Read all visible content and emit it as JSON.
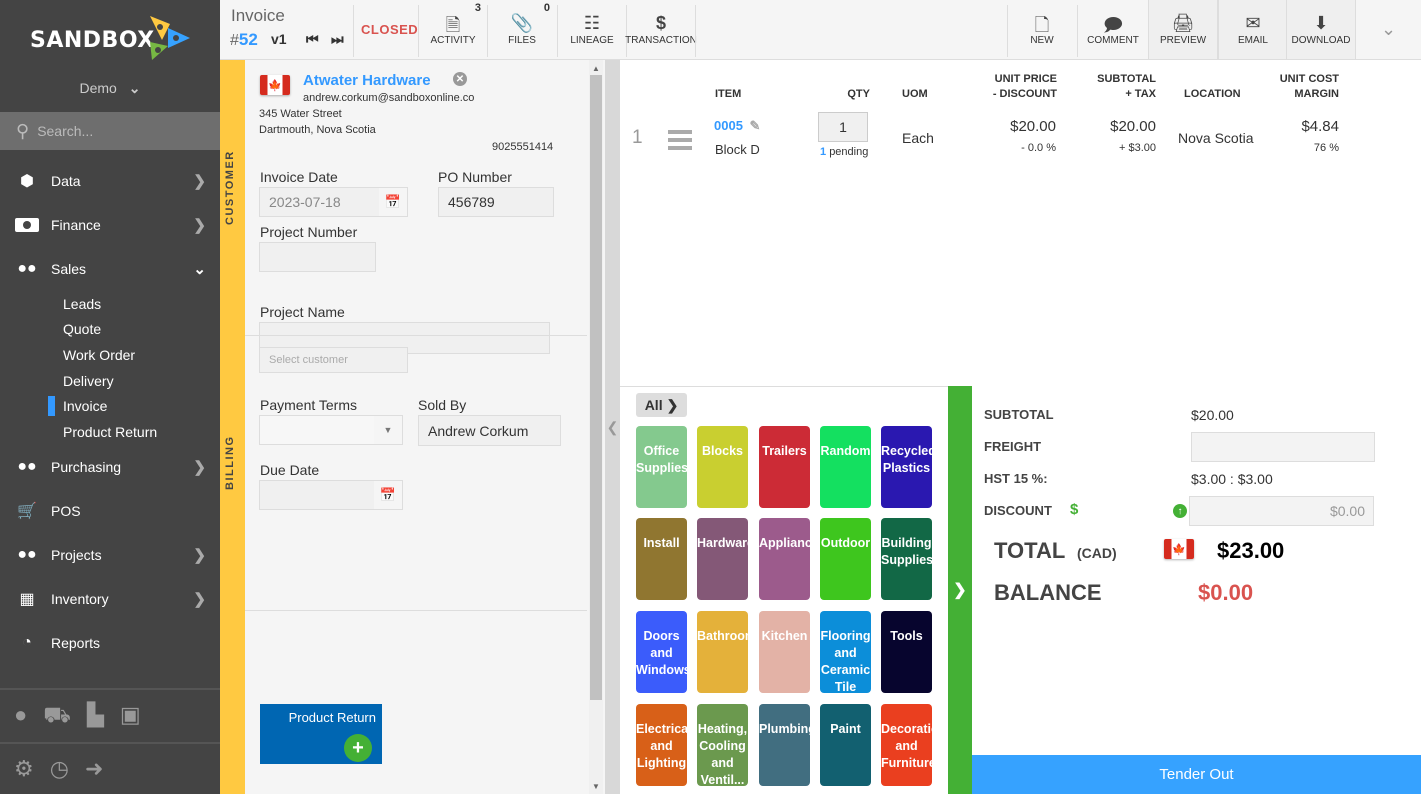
{
  "sidebar": {
    "brand": "SANDBOX",
    "workspace": "Demo",
    "search_placeholder": "Search...",
    "items": [
      {
        "label": "Data",
        "icon": "cube-icon"
      },
      {
        "label": "Finance",
        "icon": "money-icon"
      },
      {
        "label": "Sales",
        "icon": "users-icon"
      },
      {
        "label": "Purchasing",
        "icon": "users-icon"
      },
      {
        "label": "POS",
        "icon": "cart-icon"
      },
      {
        "label": "Projects",
        "icon": "users-icon"
      },
      {
        "label": "Inventory",
        "icon": "boxes-icon"
      },
      {
        "label": "Reports",
        "icon": "pie-chart-icon"
      }
    ],
    "sales_sub": [
      "Leads",
      "Quote",
      "Work Order",
      "Delivery",
      "Invoice",
      "Product Return"
    ],
    "active_sub": "Invoice"
  },
  "topbar": {
    "doc_type": "Invoice",
    "hash": "#",
    "number": "52",
    "version": "v1",
    "status": "CLOSED",
    "activity": {
      "label": "ACTIVITY",
      "count": "3"
    },
    "files": {
      "label": "FILES",
      "count": "0"
    },
    "lineage": "LINEAGE",
    "transaction": "TRANSACTION",
    "new": "NEW",
    "comment": "COMMENT",
    "preview": "PREVIEW",
    "email": "EMAIL",
    "download": "DOWNLOAD"
  },
  "form": {
    "customer_section": "CUSTOMER",
    "billing_section": "BILLING",
    "customer": {
      "name": "Atwater Hardware",
      "email": "andrew.corkum@sandboxonline.co",
      "address1": "345 Water Street",
      "address2": "Dartmouth, Nova Scotia",
      "phone": "9025551414"
    },
    "invoice_date": {
      "label": "Invoice Date",
      "value": "2023-07-18"
    },
    "po_number": {
      "label": "PO Number",
      "value": "456789"
    },
    "project_number": {
      "label": "Project Number",
      "value": ""
    },
    "project_name": {
      "label": "Project Name",
      "value": ""
    },
    "select_customer_placeholder": "Select customer",
    "payment_terms": {
      "label": "Payment Terms",
      "value": ""
    },
    "sold_by": {
      "label": "Sold By",
      "value": "Andrew Corkum"
    },
    "due_date": {
      "label": "Due Date",
      "value": ""
    },
    "product_return_button": "Product Return"
  },
  "lines": {
    "headers": {
      "item": "ITEM",
      "qty": "QTY",
      "uom": "UOM",
      "unit_price": "UNIT PRICE",
      "discount": "- DISCOUNT",
      "subtotal": "SUBTOTAL",
      "tax": "+ TAX",
      "location": "LOCATION",
      "unit_cost": "UNIT COST",
      "margin": "MARGIN"
    },
    "rows": [
      {
        "index": "1",
        "item_code": "0005",
        "item_name": "Block D",
        "qty": "1",
        "pending_count": "1",
        "pending_label": "pending",
        "uom": "Each",
        "unit_price": "$20.00",
        "discount": "- 0.0 %",
        "subtotal": "$20.00",
        "tax": "+ $3.00",
        "location": "Nova Scotia",
        "unit_cost": "$4.84",
        "margin": "76 %"
      }
    ]
  },
  "categories": {
    "all_label": "All",
    "items": [
      {
        "label": "Office Supplies",
        "color": "#84c98e"
      },
      {
        "label": "Blocks",
        "color": "#c9cf30"
      },
      {
        "label": "Trailers",
        "color": "#cc2b36"
      },
      {
        "label": "Random",
        "color": "#14e060"
      },
      {
        "label": "Recycled Plastics",
        "color": "#2a18b0"
      },
      {
        "label": "Install",
        "color": "#907630"
      },
      {
        "label": "Hardware",
        "color": "#845877"
      },
      {
        "label": "Appliances",
        "color": "#9c5b8c"
      },
      {
        "label": "Outdoor",
        "color": "#3ec61e"
      },
      {
        "label": "Building Supplies",
        "color": "#126846"
      },
      {
        "label": "Doors and Windows",
        "color": "#3b5cfb"
      },
      {
        "label": "Bathroom",
        "color": "#e4b13a"
      },
      {
        "label": "Kitchen",
        "color": "#e3b2a6"
      },
      {
        "label": "Flooring and Ceramic Tile",
        "color": "#0c8ed9"
      },
      {
        "label": "Tools",
        "color": "#07052e"
      },
      {
        "label": "Electrical and Lighting",
        "color": "#d86018"
      },
      {
        "label": "Heating, Cooling and Ventil...",
        "color": "#6b994e"
      },
      {
        "label": "Plumbing",
        "color": "#416e80"
      },
      {
        "label": "Paint",
        "color": "#126070"
      },
      {
        "label": "Decoration and Furniture",
        "color": "#ea3f1f"
      }
    ]
  },
  "totals": {
    "subtotal_label": "SUBTOTAL",
    "subtotal": "$20.00",
    "freight_label": "FREIGHT",
    "freight": "",
    "tax_label": "HST 15 %:",
    "tax": "$3.00 : $3.00",
    "discount_label": "DISCOUNT",
    "discount_symbol": "$",
    "discount_placeholder": "$0.00",
    "total_label": "TOTAL",
    "currency": "(CAD)",
    "total": "$23.00",
    "balance_label": "BALANCE",
    "balance": "$0.00",
    "tender_button": "Tender Out"
  }
}
